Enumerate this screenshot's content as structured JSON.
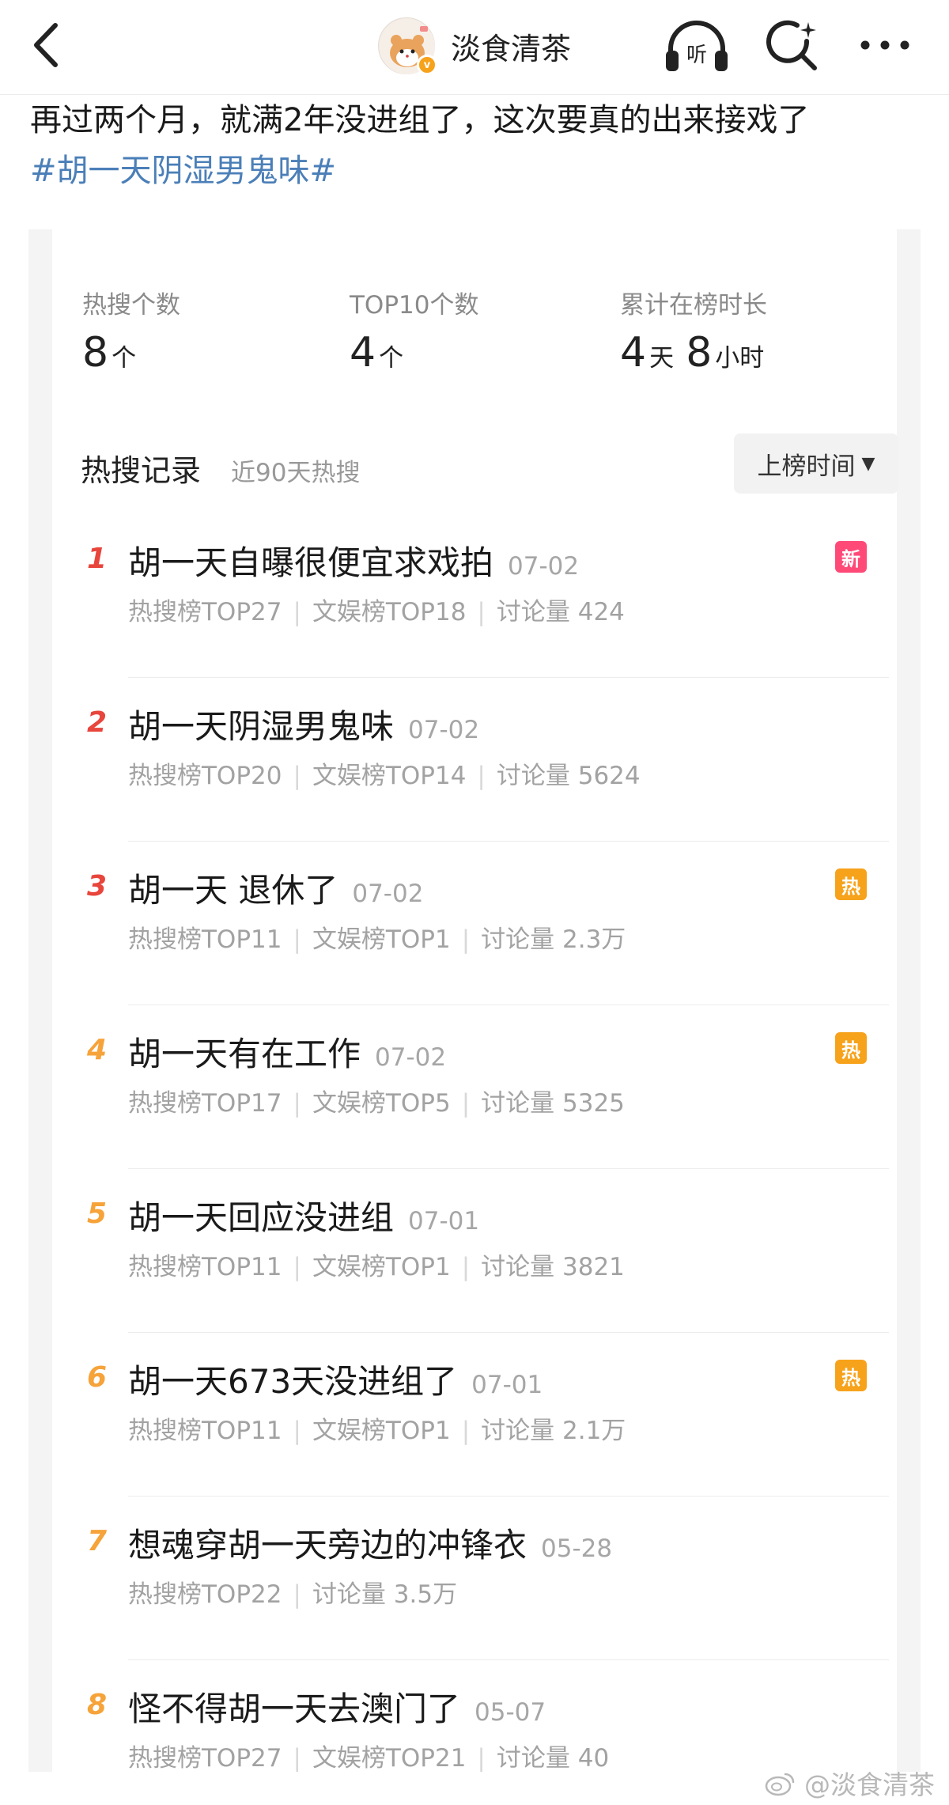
{
  "header": {
    "author_name": "淡食清茶",
    "listen_label": "听",
    "verified_label": "v"
  },
  "post": {
    "text": "再过两个月，就满2年没进组了，这次要真的出来接戏了",
    "hashtag": "#胡一天阴湿男鬼味#"
  },
  "stats": [
    {
      "label": "热搜个数",
      "value": "8",
      "unit": "个"
    },
    {
      "label": "TOP10个数",
      "value": "4",
      "unit": "个"
    },
    {
      "label": "累计在榜时长",
      "value_days": "4",
      "unit_days": "天",
      "value_hours": "8",
      "unit_hours": "小时"
    }
  ],
  "records": {
    "title": "热搜记录",
    "subtitle": "近90天热搜",
    "sort_label": "上榜时间",
    "items": [
      {
        "rank": "1",
        "title": "胡一天自曝很便宜求戏拍",
        "date": "07-02",
        "meta": [
          "热搜榜TOP27",
          "文娱榜TOP18",
          "讨论量 424"
        ],
        "badge": "新"
      },
      {
        "rank": "2",
        "title": "胡一天阴湿男鬼味",
        "date": "07-02",
        "meta": [
          "热搜榜TOP20",
          "文娱榜TOP14",
          "讨论量 5624"
        ],
        "badge": ""
      },
      {
        "rank": "3",
        "title": "胡一天 退休了",
        "date": "07-02",
        "meta": [
          "热搜榜TOP11",
          "文娱榜TOP1",
          "讨论量 2.3万"
        ],
        "badge": "热"
      },
      {
        "rank": "4",
        "title": "胡一天有在工作",
        "date": "07-02",
        "meta": [
          "热搜榜TOP17",
          "文娱榜TOP5",
          "讨论量 5325"
        ],
        "badge": "热"
      },
      {
        "rank": "5",
        "title": "胡一天回应没进组",
        "date": "07-01",
        "meta": [
          "热搜榜TOP11",
          "文娱榜TOP1",
          "讨论量 3821"
        ],
        "badge": ""
      },
      {
        "rank": "6",
        "title": "胡一天673天没进组了",
        "date": "07-01",
        "meta": [
          "热搜榜TOP11",
          "文娱榜TOP1",
          "讨论量 2.1万"
        ],
        "badge": "热"
      },
      {
        "rank": "7",
        "title": "想魂穿胡一天旁边的冲锋衣",
        "date": "05-28",
        "meta": [
          "热搜榜TOP22",
          "讨论量 3.5万"
        ],
        "badge": ""
      },
      {
        "rank": "8",
        "title": "怪不得胡一天去澳门了",
        "date": "05-07",
        "meta": [
          "热搜榜TOP27",
          "文娱榜TOP21",
          "讨论量 40"
        ],
        "badge": ""
      }
    ]
  },
  "watermark": "@淡食清茶",
  "colors": {
    "rank_top3": "#e8453c",
    "rank_other": "#f6a33a",
    "badge_new": "#ff4a78",
    "badge_hot": "#f7a21b",
    "hashtag": "#4b7fb8"
  }
}
